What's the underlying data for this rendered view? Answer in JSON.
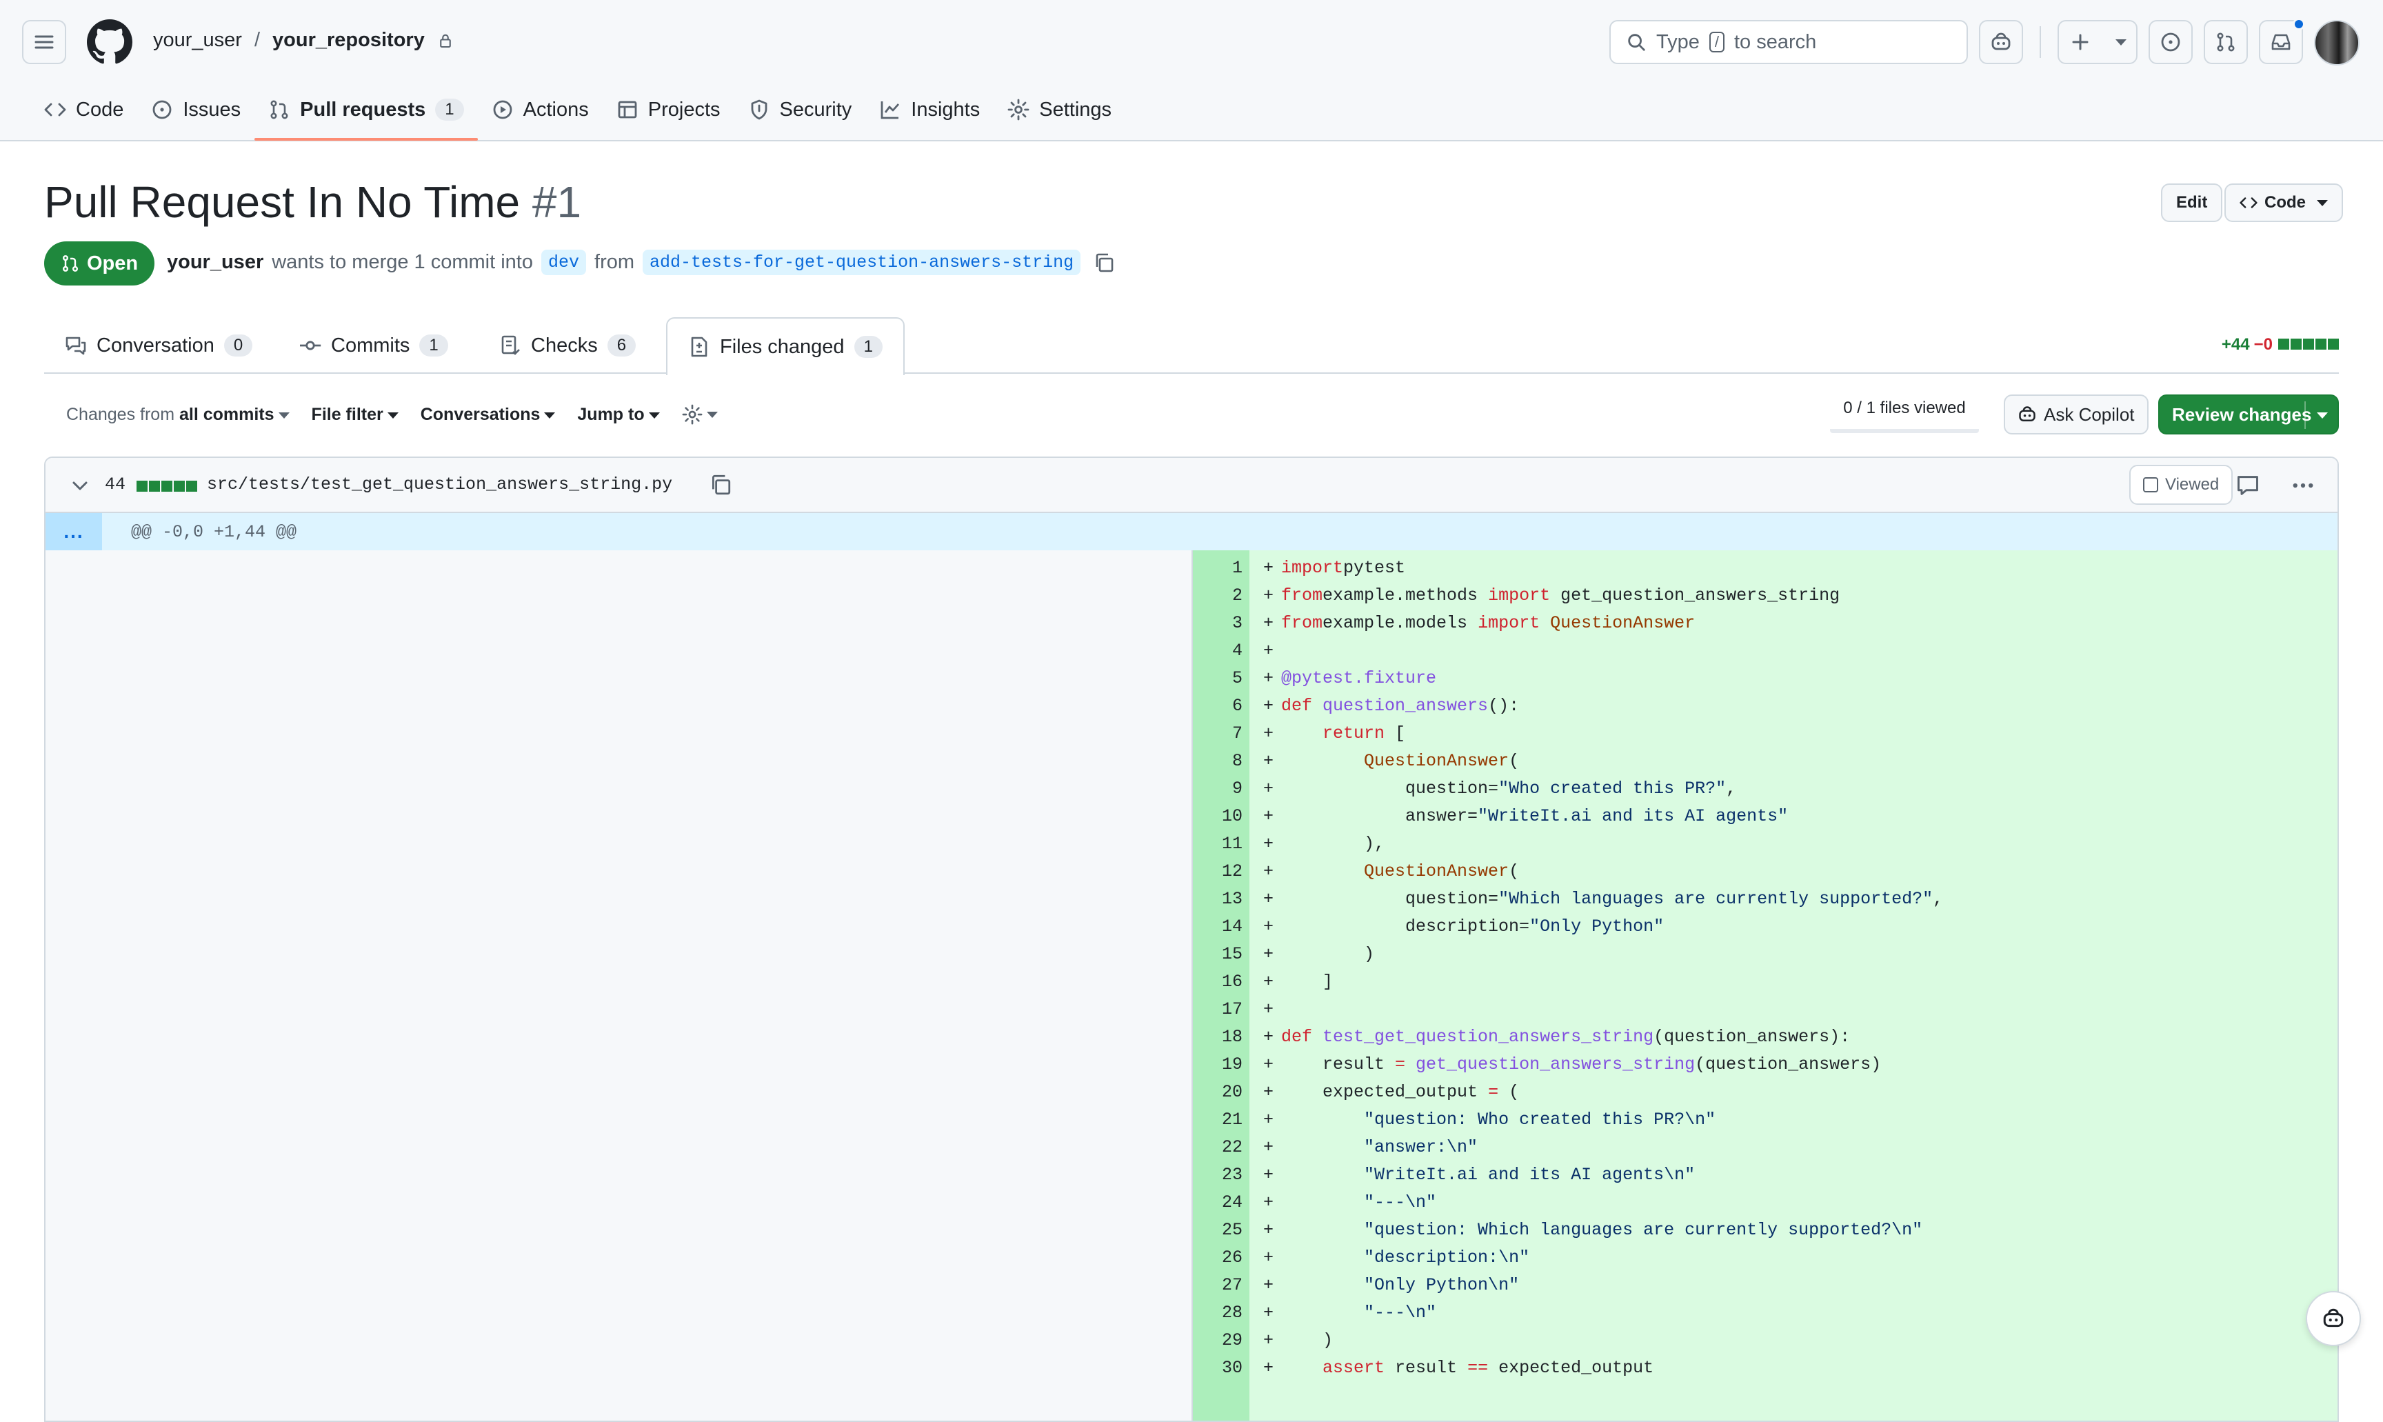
{
  "header": {
    "owner": "your_user",
    "separator": "/",
    "repo": "your_repository",
    "search_prefix": "Type",
    "search_key": "/",
    "search_suffix": "to search"
  },
  "nav": [
    {
      "label": "Code",
      "icon": "code-icon"
    },
    {
      "label": "Issues",
      "icon": "issue-opened-icon"
    },
    {
      "label": "Pull requests",
      "icon": "git-pull-request-icon",
      "count": "1",
      "active": true
    },
    {
      "label": "Actions",
      "icon": "play-icon"
    },
    {
      "label": "Projects",
      "icon": "table-icon"
    },
    {
      "label": "Security",
      "icon": "shield-icon"
    },
    {
      "label": "Insights",
      "icon": "graph-icon"
    },
    {
      "label": "Settings",
      "icon": "gear-icon"
    }
  ],
  "pr": {
    "title": "Pull Request In No Time",
    "number": "#1",
    "state": "Open",
    "author": "your_user",
    "merge_text": "wants to merge 1 commit into",
    "base": "dev",
    "from_word": "from",
    "head": "add-tests-for-get-question-answers-string",
    "edit_label": "Edit",
    "code_label": "Code"
  },
  "tabs": [
    {
      "label": "Conversation",
      "count": "0",
      "icon": "comment-discussion-icon"
    },
    {
      "label": "Commits",
      "count": "1",
      "icon": "git-commit-icon"
    },
    {
      "label": "Checks",
      "count": "6",
      "icon": "checklist-icon"
    },
    {
      "label": "Files changed",
      "count": "1",
      "icon": "file-diff-icon",
      "active": true
    }
  ],
  "diffstat": {
    "additions": "+44",
    "deletions": "−0"
  },
  "toolbar": {
    "changes_prefix": "Changes from",
    "changes_value": "all commits",
    "file_filter": "File filter",
    "conversations": "Conversations",
    "jump_to": "Jump to",
    "files_viewed": "0 / 1 files viewed",
    "ask_copilot": "Ask Copilot",
    "review_changes": "Review changes"
  },
  "file": {
    "changed_count": "44",
    "path": "src/tests/test_get_question_answers_string.py",
    "viewed_label": "Viewed",
    "hunk_expand": "...",
    "hunk_header": "@@ -0,0 +1,44 @@"
  },
  "code_lines": [
    {
      "n": "1",
      "parts": [
        [
          "kw",
          "import"
        ],
        [
          "",
          "pytest"
        ]
      ]
    },
    {
      "n": "2",
      "parts": [
        [
          "kw",
          "from"
        ],
        [
          "",
          "example.methods "
        ],
        [
          "kw",
          "import"
        ],
        [
          "",
          " get_question_answers_string"
        ]
      ]
    },
    {
      "n": "3",
      "parts": [
        [
          "kw",
          "from"
        ],
        [
          "",
          "example.models "
        ],
        [
          "kw",
          "import"
        ],
        [
          "cls",
          " QuestionAnswer"
        ]
      ]
    },
    {
      "n": "4",
      "parts": []
    },
    {
      "n": "5",
      "parts": [
        [
          "dec",
          "@pytest.fixture"
        ]
      ]
    },
    {
      "n": "6",
      "parts": [
        [
          "kw",
          "def"
        ],
        [
          "fn",
          " question_answers"
        ],
        [
          "",
          "():"
        ]
      ]
    },
    {
      "n": "7",
      "parts": [
        [
          "",
          "    "
        ],
        [
          "kw",
          "return"
        ],
        [
          "",
          " ["
        ]
      ]
    },
    {
      "n": "8",
      "parts": [
        [
          "",
          "        "
        ],
        [
          "cls",
          "QuestionAnswer"
        ],
        [
          "",
          "("
        ]
      ]
    },
    {
      "n": "9",
      "parts": [
        [
          "",
          "            question="
        ],
        [
          "str",
          "\"Who created this PR?\""
        ],
        [
          "",
          ","
        ]
      ]
    },
    {
      "n": "10",
      "parts": [
        [
          "",
          "            answer="
        ],
        [
          "str",
          "\"WriteIt.ai and its AI agents\""
        ]
      ]
    },
    {
      "n": "11",
      "parts": [
        [
          "",
          "        ),"
        ]
      ]
    },
    {
      "n": "12",
      "parts": [
        [
          "",
          "        "
        ],
        [
          "cls",
          "QuestionAnswer"
        ],
        [
          "",
          "("
        ]
      ]
    },
    {
      "n": "13",
      "parts": [
        [
          "",
          "            question="
        ],
        [
          "str",
          "\"Which languages are currently supported?\""
        ],
        [
          "",
          ","
        ]
      ]
    },
    {
      "n": "14",
      "parts": [
        [
          "",
          "            description="
        ],
        [
          "str",
          "\"Only Python\""
        ]
      ]
    },
    {
      "n": "15",
      "parts": [
        [
          "",
          "        )"
        ]
      ]
    },
    {
      "n": "16",
      "parts": [
        [
          "",
          "    ]"
        ]
      ]
    },
    {
      "n": "17",
      "parts": []
    },
    {
      "n": "18",
      "parts": [
        [
          "kw",
          "def"
        ],
        [
          "fn",
          " test_get_question_answers_string"
        ],
        [
          "",
          "(question_answers):"
        ]
      ]
    },
    {
      "n": "19",
      "parts": [
        [
          "",
          "    result "
        ],
        [
          "kw",
          "="
        ],
        [
          "fn",
          " get_question_answers_string"
        ],
        [
          "",
          "(question_answers)"
        ]
      ]
    },
    {
      "n": "20",
      "parts": [
        [
          "",
          "    expected_output "
        ],
        [
          "kw",
          "="
        ],
        [
          "",
          " ("
        ]
      ]
    },
    {
      "n": "21",
      "parts": [
        [
          "",
          "        "
        ],
        [
          "str",
          "\"question: Who created this PR?\\n\""
        ]
      ]
    },
    {
      "n": "22",
      "parts": [
        [
          "",
          "        "
        ],
        [
          "str",
          "\"answer:\\n\""
        ]
      ]
    },
    {
      "n": "23",
      "parts": [
        [
          "",
          "        "
        ],
        [
          "str",
          "\"WriteIt.ai and its AI agents\\n\""
        ]
      ]
    },
    {
      "n": "24",
      "parts": [
        [
          "",
          "        "
        ],
        [
          "str",
          "\"---\\n\""
        ]
      ]
    },
    {
      "n": "25",
      "parts": [
        [
          "",
          "        "
        ],
        [
          "str",
          "\"question: Which languages are currently supported?\\n\""
        ]
      ]
    },
    {
      "n": "26",
      "parts": [
        [
          "",
          "        "
        ],
        [
          "str",
          "\"description:\\n\""
        ]
      ]
    },
    {
      "n": "27",
      "parts": [
        [
          "",
          "        "
        ],
        [
          "str",
          "\"Only Python\\n\""
        ]
      ]
    },
    {
      "n": "28",
      "parts": [
        [
          "",
          "        "
        ],
        [
          "str",
          "\"---\\n\""
        ]
      ]
    },
    {
      "n": "29",
      "parts": [
        [
          "",
          "    )"
        ]
      ]
    },
    {
      "n": "30",
      "parts": [
        [
          "",
          "    "
        ],
        [
          "kw",
          "assert"
        ],
        [
          "",
          " result "
        ],
        [
          "kw",
          "=="
        ],
        [
          "",
          " expected_output"
        ]
      ]
    }
  ]
}
